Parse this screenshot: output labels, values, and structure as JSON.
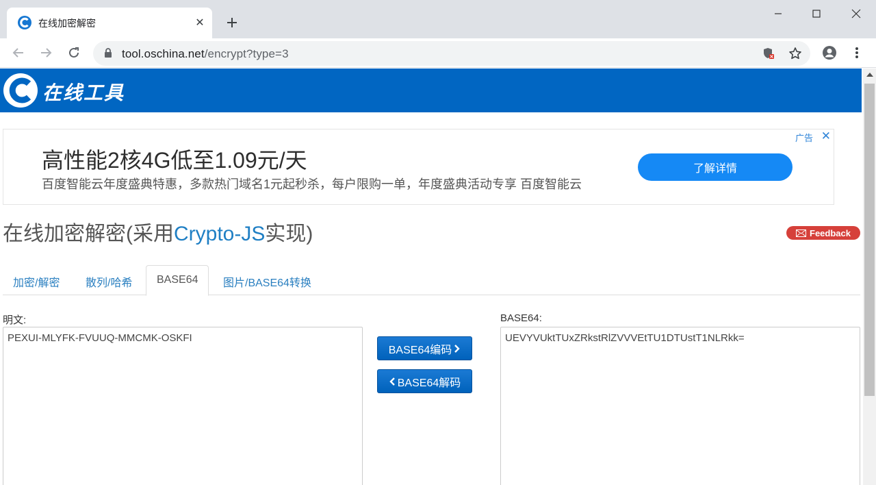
{
  "browser": {
    "tab_title": "在线加密解密",
    "url_host": "tool.oschina.net",
    "url_path": "/encrypt?type=3"
  },
  "site": {
    "logo_text": "在线工具"
  },
  "ad": {
    "headline": "高性能2核4G低至1.09元/天",
    "description": "百度智能云年度盛典特惠，多款热门域名1元起秒杀，每户限购一单，年度盛典活动专享 百度智能云",
    "tag": "广告",
    "cta": "了解详情"
  },
  "page": {
    "title_prefix": "在线加密解密(采用",
    "title_highlight": "Crypto-JS",
    "title_suffix": "实现)",
    "feedback": "Feedback"
  },
  "tabs": [
    {
      "label": "加密/解密"
    },
    {
      "label": "散列/哈希"
    },
    {
      "label": "BASE64"
    },
    {
      "label": "图片/BASE64转换"
    }
  ],
  "form": {
    "plain_label": "明文:",
    "plain_value": "PEXUI-MLYFK-FVUUQ-MMCMK-OSKFI",
    "base64_label": "BASE64:",
    "base64_value": "UEVYVUktTUxZRkstRlZVVVEtTU1DTUstT1NLRkk=",
    "encode_button": "BASE64编码",
    "decode_button": "BASE64解码"
  },
  "colors": {
    "header_blue": "#0166c2",
    "link_blue": "#1f7fc4",
    "button_blue": "#0a6dc9",
    "feedback_red": "#d6403a",
    "ad_cta_blue": "#1589f5"
  }
}
